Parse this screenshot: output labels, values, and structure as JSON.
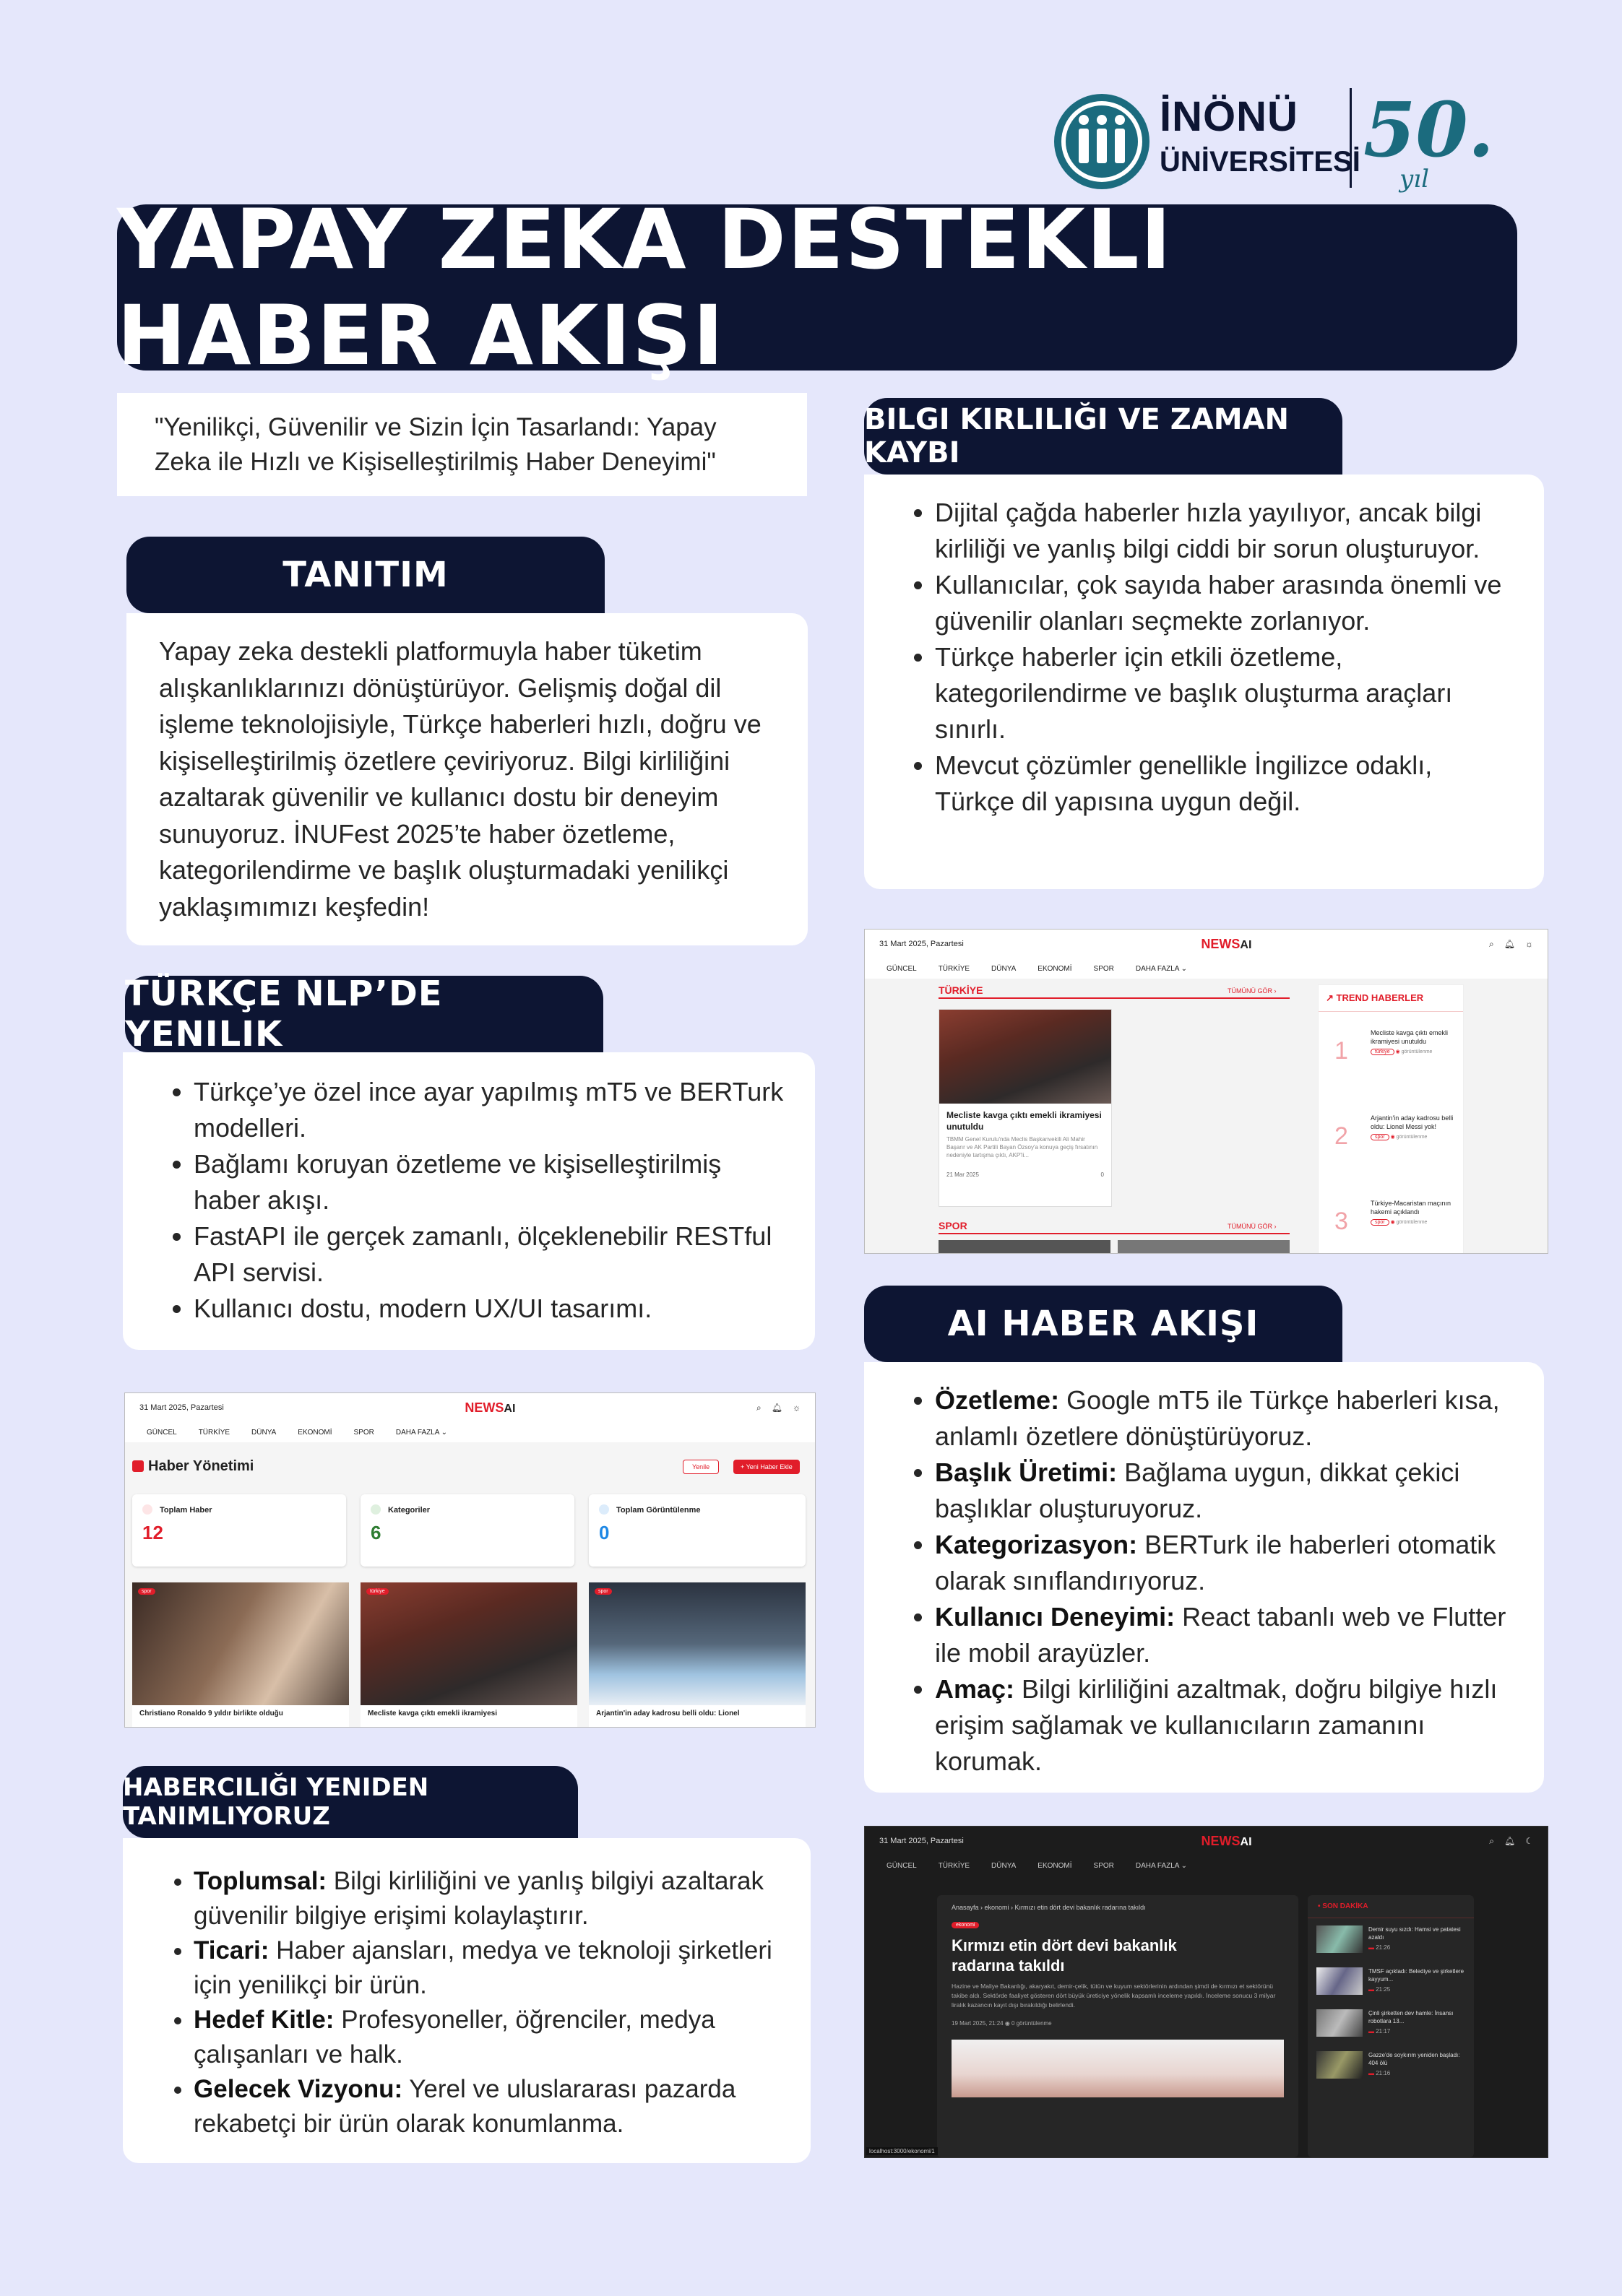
{
  "logo": {
    "line1": "İNÖNÜ",
    "line2": "ÜNİVERSİTESİ",
    "anniv": "50.",
    "anniv_sub": "yıl"
  },
  "title": "YAPAY ZEKA DESTEKLI HABER AKIŞI",
  "quote": "\"Yenilikçi, Güvenilir ve Sizin İçin Tasarlandı: Yapay Zeka ile Hızlı ve Kişiselleştirilmiş Haber Deneyimi\"",
  "tanitim": {
    "title": "TANITIM",
    "text": "Yapay zeka destekli platformuyla haber tüketim alışkanlıklarınızı dönüştürüyor. Gelişmiş doğal dil işleme teknolojisiyle, Türkçe haberleri hızlı, doğru ve kişiselleştirilmiş özetlere çeviriyoruz. Bilgi kirliliğini azaltarak güvenilir ve kullanıcı dostu bir deneyim sunuyoruz. İNUFest 2025’te haber özetleme, kategorilendirme ve başlık oluşturmadaki yenilikçi yaklaşımımızı keşfedin!"
  },
  "nlp": {
    "title": "TÜRKÇE NLP’DE YENILIK",
    "items": [
      "Türkçe’ye özel ince ayar yapılmış mT5 ve BERTurk modelleri.",
      "Bağlamı koruyan özetleme ve kişiselleştirilmiş haber akışı.",
      "FastAPI ile gerçek zamanlı, ölçeklenebilir RESTful API servisi.",
      "Kullanıcı dostu, modern UX/UI tasarımı."
    ]
  },
  "bilgi": {
    "title": "BILGI KIRLILIĞI VE ZAMAN KAYBI",
    "items": [
      "Dijital çağda haberler hızla yayılıyor, ancak bilgi kirliliği ve yanlış bilgi ciddi bir sorun oluşturuyor.",
      "Kullanıcılar, çok sayıda haber arasında önemli ve güvenilir olanları seçmekte zorlanıyor.",
      "Türkçe haberler için etkili özetleme, kategorilendirme ve başlık oluşturma araçları sınırlı.",
      "Mevcut çözümler genellikle İngilizce odaklı, Türkçe dil yapısına uygun değil."
    ]
  },
  "akis": {
    "title": "AI HABER AKIŞI",
    "items": [
      {
        "k": "Özetleme:",
        "v": " Google mT5 ile Türkçe haberleri kısa, anlamlı özetlere dönüştürüyoruz."
      },
      {
        "k": "Başlık Üretimi:",
        "v": " Bağlama uygun, dikkat çekici başlıklar oluşturuyoruz."
      },
      {
        "k": "Kategorizasyon:",
        "v": " BERTurk ile haberleri otomatik olarak sınıflandırıyoruz."
      },
      {
        "k": "Kullanıcı Deneyimi:",
        "v": " React tabanlı web ve Flutter ile mobil arayüzler."
      },
      {
        "k": "Amaç:",
        "v": " Bilgi kirliliğini azaltmak, doğru bilgiye hızlı erişim sağlamak ve kullanıcıların zamanını korumak."
      }
    ]
  },
  "haber": {
    "title": "HABERCILIĞI YENIDEN TANIMLIYORUZ",
    "items": [
      {
        "k": "Toplumsal:",
        "v": " Bilgi kirliliğini ve yanlış bilgiyi azaltarak güvenilir bilgiye erişimi kolaylaştırır."
      },
      {
        "k": "Ticari:",
        "v": " Haber ajansları, medya ve teknoloji şirketleri için yenilikçi bir ürün."
      },
      {
        "k": "Hedef Kitle:",
        "v": " Profesyoneller, öğrenciler, medya çalışanları ve halk."
      },
      {
        "k": "Gelecek Vizyonu:",
        "v": " Yerel ve uluslararası pazarda rekabetçi bir ürün olarak konumlanma."
      }
    ]
  },
  "app": {
    "date": "31 Mart 2025, Pazartesi",
    "brand": "NEWS",
    "brand_ai": "AI",
    "nav": [
      "GÜNCEL",
      "TÜRKİYE",
      "DÜNYA",
      "EKONOMİ",
      "SPOR",
      "DAHA FAZLA ⌄"
    ]
  },
  "shot1": {
    "section1": "TÜRKİYE",
    "see_all": "TÜMÜNÜ GÖR ›",
    "article_title": "Mecliste kavga çıktı emekli ikramiyesi unutuldu",
    "article_snip": "TBMM Genel Kurulu'nda Meclis Başkanvekili Ali Mahir Başarır ve AK Partili Bayan Özsoy'a konuya geçiş fırsatının nedeniyle tartışma çıktı, AKP'li...",
    "article_date": "21 Mar 2025",
    "article_views": "0",
    "section2": "SPOR",
    "trend_title": "TREND HABERLER",
    "trends": [
      {
        "n": "1",
        "t": "Mecliste kavga çıktı emekli ikramiyesi unutuldu",
        "tag": "türkiye"
      },
      {
        "n": "2",
        "t": "Arjantin'in aday kadrosu belli oldu: Lionel Messi yok!",
        "tag": "spor"
      },
      {
        "n": "3",
        "t": "Türkiye-Macaristan maçının hakemi açıklandı",
        "tag": "spor"
      }
    ],
    "views_label": "görüntülenme"
  },
  "shot2": {
    "title": "Haber Yönetimi",
    "refresh": "Yenile",
    "new": "+ Yeni Haber Ekle",
    "stats": [
      {
        "label": "Toplam Haber",
        "value": "12",
        "color": "#e11d2a"
      },
      {
        "label": "Kategoriler",
        "value": "6",
        "color": "#2e7d32"
      },
      {
        "label": "Toplam Görüntülenme",
        "value": "0",
        "color": "#1e88e5"
      }
    ],
    "cards": [
      {
        "tag": "spor",
        "title": "Christiano Ronaldo 9 yıldır birlikte olduğu"
      },
      {
        "tag": "türkiye",
        "title": "Mecliste kavga çıktı emekli ikramiyesi"
      },
      {
        "tag": "spor",
        "title": "Arjantin'in aday kadrosu belli oldu: Lionel"
      }
    ]
  },
  "shot3": {
    "breadcrumb": "Anasayfa  ›  ekonomi  ›  Kırmızı etin dört devi bakanlık radarına takıldı",
    "tag": "ekonomi",
    "headline": "Kırmızı etin dört devi bakanlık radarına takıldı",
    "snip": "Hazine ve Maliye Bakanlığı, akaryakıt, demir-çelik, tütün ve kuyum sektörlerinin ardından şimdi de kırmızı et sektörünü takibe aldı. Sektörde faaliyet gösteren dört büyük üreticiye yönelik kapsamlı inceleme yapıldı. İnceleme sonucu 3 milyar liralık kazancın kayıt dışı bırakıldığı belirlendi.",
    "meta": "19 Mart 2025, 21:24   ◉ 0 görüntülenme",
    "side_title": "SON DAKİKA",
    "side": [
      {
        "t": "Demir suyu sızdı: Hamsi ve patatesi azaldı",
        "time": "21:26"
      },
      {
        "t": "TMSF açıkladı: Belediye ve şirketlere kayyum...",
        "time": "21:25"
      },
      {
        "t": "Çinli şirketten dev hamle: İnsansı robotlara 13...",
        "time": "21:17"
      },
      {
        "t": "Gazze'de soykırım yeniden başladı: 404 ölü",
        "time": "21:16"
      }
    ],
    "status": "localhost:3000/ekonomi/1"
  }
}
